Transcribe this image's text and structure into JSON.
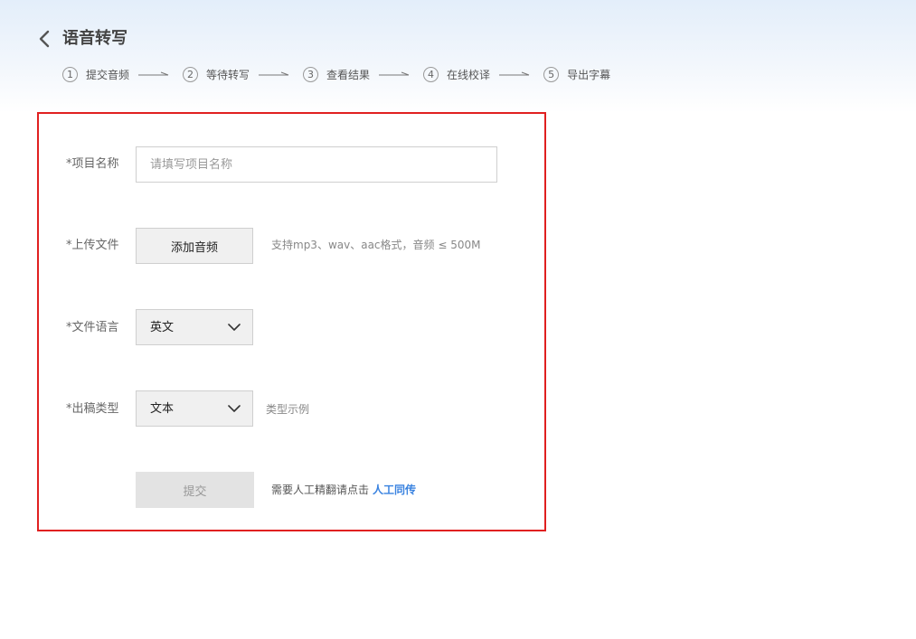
{
  "header": {
    "title": "语音转写",
    "steps": [
      {
        "num": "1",
        "label": "提交音频"
      },
      {
        "num": "2",
        "label": "等待转写"
      },
      {
        "num": "3",
        "label": "查看结果"
      },
      {
        "num": "4",
        "label": "在线校译"
      },
      {
        "num": "5",
        "label": "导出字幕"
      }
    ]
  },
  "form": {
    "project_name": {
      "label": "*项目名称",
      "placeholder": "请填写项目名称",
      "value": ""
    },
    "upload": {
      "label": "*上传文件",
      "button": "添加音频",
      "hint": "支持mp3、wav、aac格式，音频 ≤ 500M"
    },
    "language": {
      "label": "*文件语言",
      "selected": "英文"
    },
    "output_type": {
      "label": "*出稿类型",
      "selected": "文本",
      "hint": "类型示例"
    },
    "submit": {
      "label": "提交"
    },
    "note": {
      "text": "需要人工精翻请点击",
      "link": "人工同传"
    }
  },
  "colors": {
    "highlight_border": "#e02020",
    "link": "#3a83e0",
    "submit_bg": "#e3e3e3"
  }
}
